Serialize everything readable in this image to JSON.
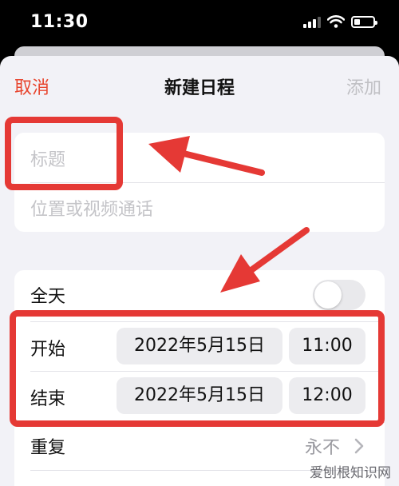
{
  "status_bar": {
    "time": "11:30",
    "battery_level": 0.3
  },
  "nav": {
    "cancel": "取消",
    "title": "新建日程",
    "add": "添加"
  },
  "form": {
    "title_placeholder": "标题",
    "location_placeholder": "位置或视频通话"
  },
  "schedule": {
    "all_day_label": "全天",
    "all_day": false,
    "start_label": "开始",
    "start_date": "2022年5月15日",
    "start_time": "11:00",
    "end_label": "结束",
    "end_date": "2022年5月15日",
    "end_time": "12:00",
    "repeat_label": "重复",
    "repeat_value": "永不"
  },
  "watermark": "爱刨根知识网",
  "colors": {
    "accent": "#e8452e",
    "annotation": "#e53935",
    "background": "#f2f2f7"
  }
}
